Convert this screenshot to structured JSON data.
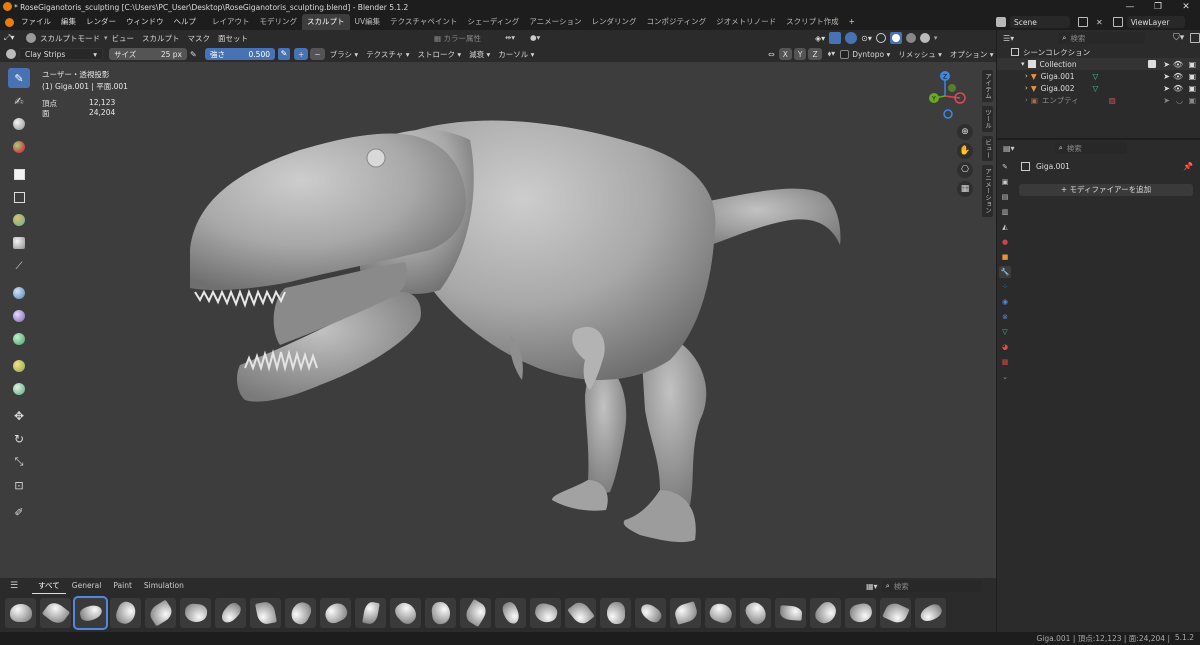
{
  "window": {
    "title": "* RoseGiganotoris_sculpting [C:\\Users\\PC_User\\Desktop\\RoseGiganotoris_sculpting.blend] - Blender 5.1.2",
    "minimize": "—",
    "maximize": "❐",
    "close": "✕"
  },
  "menubar": {
    "items": [
      "ファイル",
      "編集",
      "レンダー",
      "ウィンドウ",
      "ヘルプ"
    ],
    "workspaces": [
      "レイアウト",
      "モデリング",
      "スカルプト",
      "UV編集",
      "テクスチャペイント",
      "シェーディング",
      "アニメーション",
      "レンダリング",
      "コンポジティング",
      "ジオメトリノード",
      "スクリプト作成"
    ],
    "active_workspace": "スカルプト",
    "add_workspace": "+",
    "scene": "Scene",
    "view_layer": "ViewLayer"
  },
  "viewport_header": {
    "mode": "スカルプトモード",
    "menus": [
      "ビュー",
      "スカルプト",
      "マスク",
      "面セット"
    ],
    "color_attr": "カラー属性",
    "x": "X",
    "y": "Y",
    "z": "Z",
    "dyntopo": "Dyntopo",
    "remesh": "リメッシュ",
    "options": "オプション"
  },
  "tool_settings": {
    "brush": "Clay Strips",
    "size_label": "サイズ",
    "size_value": "25 px",
    "strength_label": "強さ",
    "strength_value": "0.500",
    "plus": "+",
    "minus": "−",
    "menus": [
      "ブラシ",
      "テクスチャ",
      "ストローク",
      "減衰",
      "カーソル"
    ]
  },
  "viewport": {
    "view_name": "ユーザー・透視投影",
    "object_info": "(1) Giga.001 | 平面.001",
    "stats": [
      {
        "label": "頂点",
        "value": "12,123"
      },
      {
        "label": "面",
        "value": "24,204"
      }
    ],
    "gizmo": {
      "x": "X",
      "y": "Y",
      "z": "Z"
    },
    "side_tabs": [
      "アイテム",
      "ツール",
      "ビュー",
      "アニメーション"
    ]
  },
  "asset_shelf": {
    "tabs": [
      "すべて",
      "General",
      "Paint",
      "Simulation"
    ],
    "active_tab": "すべて",
    "search_placeholder": "検索",
    "brush_count": 27,
    "selected_index": 2
  },
  "outliner": {
    "search_placeholder": "検索",
    "root": "シーンコレクション",
    "collection": "Collection",
    "objects": [
      "Giga.001",
      "Giga.002",
      "エンプティ"
    ]
  },
  "properties": {
    "search_placeholder": "検索",
    "object_name": "Giga.001",
    "add_modifier": "+ モディファイアーを追加"
  },
  "statusbar": {
    "text": "Giga.001 | 頂点:12,123 | 面:24,204 | ",
    "version": "5.1.2"
  },
  "colors": {
    "accent": "#4772b3",
    "viewport_bg": "#3d3d3d",
    "panel_bg": "#2b2b2b",
    "header_bg": "#1d1d1d",
    "axis_x": "#e04656",
    "axis_y": "#6aa925",
    "axis_z": "#3d87e6"
  }
}
